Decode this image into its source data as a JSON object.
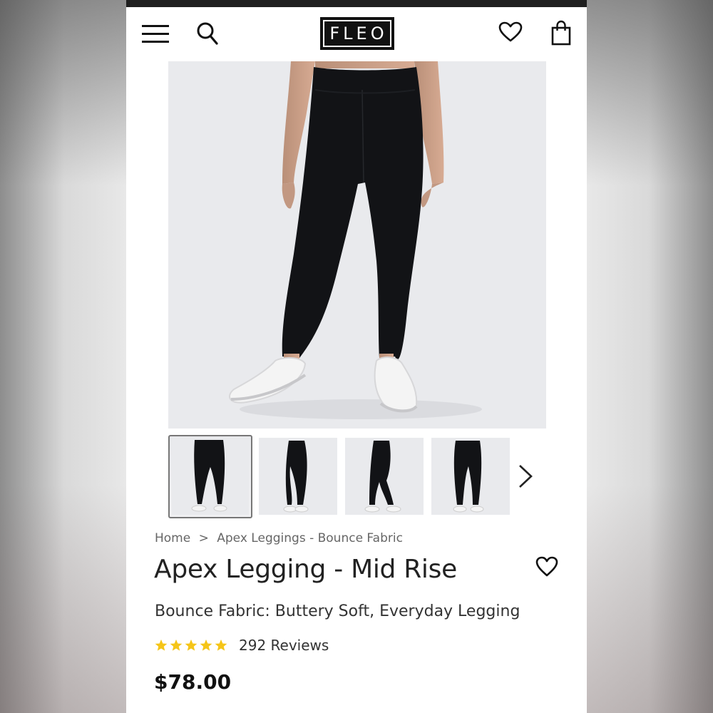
{
  "header": {
    "logo_text": "FLEO",
    "icons": [
      "hamburger-menu-icon",
      "search-icon",
      "heart-icon",
      "shopping-bag-icon"
    ]
  },
  "gallery": {
    "thumbnails_count": 4,
    "next_icon": "chevron-right-icon"
  },
  "breadcrumb": {
    "home": "Home",
    "separator": ">",
    "category": "Apex Leggings - Bounce Fabric"
  },
  "product": {
    "title": "Apex Legging - Mid Rise",
    "subtitle": "Bounce Fabric: Buttery Soft, Everyday Legging",
    "rating_stars": 5,
    "reviews_label": "292 Reviews",
    "price": "$78.00"
  },
  "colors": {
    "star": "#f5c518",
    "text": "#222222",
    "legging": "#121316",
    "shoe": "#f4f4f4"
  }
}
